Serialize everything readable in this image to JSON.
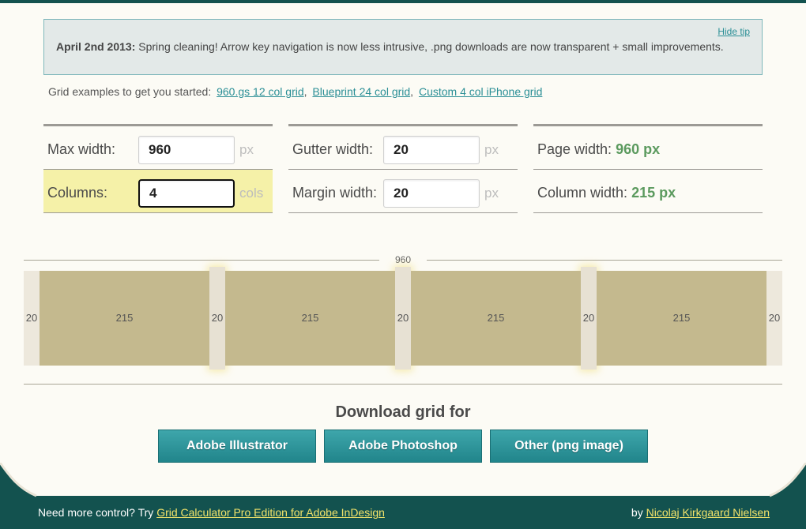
{
  "tip": {
    "date": "April 2nd 2013:",
    "message": "Spring cleaning! Arrow key navigation is now less intrusive, .png downloads are now transparent + small improvements.",
    "hide_label": "Hide tip"
  },
  "examples": {
    "prefix": "Grid examples to get you started:",
    "links": [
      "960.gs 12 col grid",
      "Blueprint 24 col grid",
      "Custom 4 col iPhone grid"
    ]
  },
  "settings": {
    "max_width": {
      "label": "Max width:",
      "value": "960",
      "unit": "px"
    },
    "columns": {
      "label": "Columns:",
      "value": "4",
      "unit": "cols"
    },
    "gutter_width": {
      "label": "Gutter width:",
      "value": "20",
      "unit": "px"
    },
    "margin_width": {
      "label": "Margin width:",
      "value": "20",
      "unit": "px"
    },
    "page_width": {
      "label": "Page width:",
      "value": "960 px"
    },
    "column_width": {
      "label": "Column width:",
      "value": "215 px"
    }
  },
  "preview": {
    "total_label": "960",
    "margin_label": "20",
    "gutter_label": "20",
    "column_label": "215"
  },
  "download": {
    "title": "Download grid for",
    "buttons": [
      "Adobe Illustrator",
      "Adobe Photoshop",
      "Other (png image)"
    ]
  },
  "footer": {
    "left_prefix": "Need more control? Try",
    "left_link": "Grid Calculator Pro Edition for Adobe InDesign",
    "right_prefix": "by",
    "right_link": "Nicolaj Kirkgaard Nielsen"
  },
  "colors": {
    "accent_teal": "#2b8f96",
    "footer_bg": "#13524f",
    "column_fill": "#c4b98e",
    "highlight": "#f5f1a8",
    "result_green": "#5b9a5e"
  }
}
